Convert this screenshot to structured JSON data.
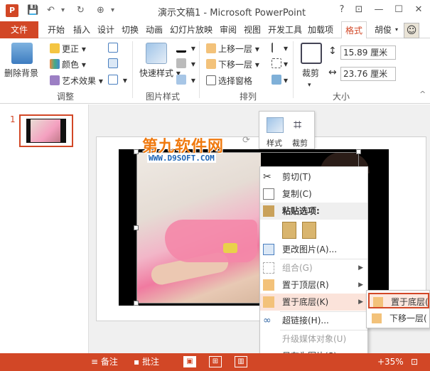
{
  "app": {
    "title": "演示文稿1 - Microsoft PowerPoint",
    "logo_letter": "P",
    "window_buttons": [
      "?",
      "⊡",
      "—",
      "☐",
      "✕"
    ]
  },
  "quick_access": [
    "💾",
    "↶",
    "▾",
    "↻",
    "⊕",
    "▾"
  ],
  "tabs": {
    "file": "文件",
    "items": [
      "开始",
      "插入",
      "设计",
      "切换",
      "动画",
      "幻灯片放映",
      "审阅",
      "视图",
      "开发工具",
      "加载项"
    ],
    "active": "格式",
    "user": "胡俊"
  },
  "ribbon": {
    "adjust": {
      "remove_bg": "删除背景",
      "correct": "更正",
      "color": "颜色",
      "art_effects": "艺术效果",
      "label": "调整"
    },
    "picture_styles": {
      "quick_styles": "快速样式",
      "label": "图片样式"
    },
    "arrange": {
      "bring_forward": "上移一层",
      "send_backward": "下移一层",
      "selection_pane": "选择窗格",
      "label": "排列"
    },
    "size": {
      "crop": "裁剪",
      "height": "15.89 厘米",
      "width": "23.76 厘米",
      "label": "大小"
    }
  },
  "thumbnails": {
    "slide_number": "1"
  },
  "watermark": {
    "line1": "第九软件网",
    "line2": "WWW.D9SOFT.COM"
  },
  "mini_toolbar": {
    "style": "样式",
    "crop": "裁剪"
  },
  "context_menu": {
    "cut": "剪切(T)",
    "copy": "复制(C)",
    "paste_options": "粘贴选项:",
    "change_picture": "更改图片(A)...",
    "group": "组合(G)",
    "bring_to_front": "置于顶层(R)",
    "send_to_back": "置于底层(K)",
    "hyperlink": "超链接(H)...",
    "upgrade_media": "升级媒体对象(U)",
    "save_as_picture": "另存为图片(S)..."
  },
  "submenu": {
    "send_to_back": "置于底层(",
    "send_backward": "下移一层("
  },
  "statusbar": {
    "notes": "备注",
    "comments": "批注",
    "zoom": "35%"
  },
  "colors": {
    "accent": "#d24726",
    "highlight": "#fbe3da"
  }
}
